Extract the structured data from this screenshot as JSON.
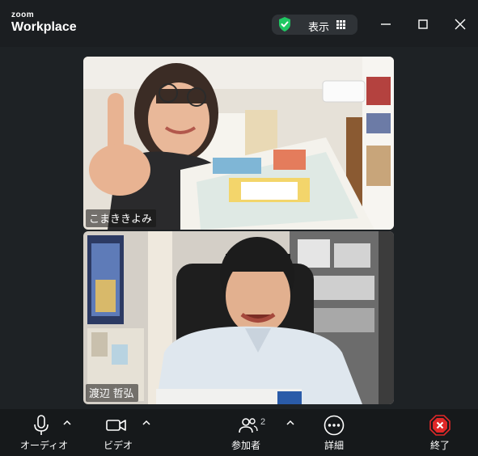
{
  "app": {
    "logo_small": "zoom",
    "logo_big": "Workplace"
  },
  "titlebar": {
    "view_label": "表示",
    "icons": [
      "shield-check-icon",
      "grid-icon",
      "minimize-icon",
      "maximize-icon",
      "close-icon"
    ]
  },
  "participants": [
    {
      "name": "こまききよみ"
    },
    {
      "name": "渡辺 哲弘"
    }
  ],
  "toolbar": {
    "audio_label": "オーディオ",
    "video_label": "ビデオ",
    "participants_label": "参加者",
    "participants_count": "2",
    "more_label": "詳細",
    "end_label": "終了"
  },
  "colors": {
    "accent_green": "#20c763",
    "end_red": "#e02828",
    "background": "#1e2225"
  }
}
